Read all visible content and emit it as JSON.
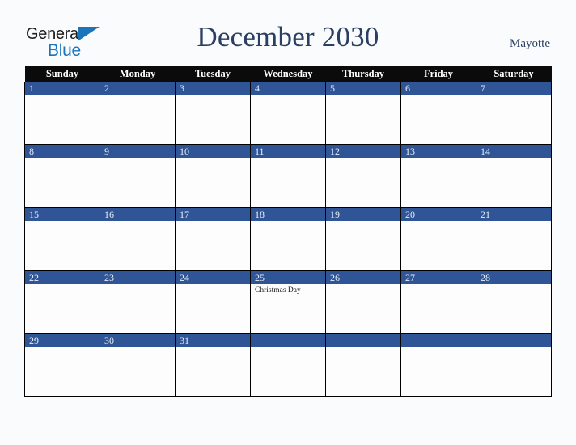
{
  "brand": {
    "name_part1": "General",
    "name_part2": "Blue",
    "triangle_icon": "triangle-logo-icon",
    "accent_color": "#1b75bc"
  },
  "header": {
    "title": "December 2030",
    "month": "December",
    "year": "2030",
    "location": "Mayotte",
    "title_color": "#2a3f63"
  },
  "calendar": {
    "header_bg": "#0b0b0b",
    "daynum_bg": "#2f5596",
    "daynum_color": "#e9eef7",
    "cell_bg": "#fdfdfd",
    "weekdays": [
      "Sunday",
      "Monday",
      "Tuesday",
      "Wednesday",
      "Thursday",
      "Friday",
      "Saturday"
    ],
    "weeks": [
      [
        {
          "day": "1",
          "events": []
        },
        {
          "day": "2",
          "events": []
        },
        {
          "day": "3",
          "events": []
        },
        {
          "day": "4",
          "events": []
        },
        {
          "day": "5",
          "events": []
        },
        {
          "day": "6",
          "events": []
        },
        {
          "day": "7",
          "events": []
        }
      ],
      [
        {
          "day": "8",
          "events": []
        },
        {
          "day": "9",
          "events": []
        },
        {
          "day": "10",
          "events": []
        },
        {
          "day": "11",
          "events": []
        },
        {
          "day": "12",
          "events": []
        },
        {
          "day": "13",
          "events": []
        },
        {
          "day": "14",
          "events": []
        }
      ],
      [
        {
          "day": "15",
          "events": []
        },
        {
          "day": "16",
          "events": []
        },
        {
          "day": "17",
          "events": []
        },
        {
          "day": "18",
          "events": []
        },
        {
          "day": "19",
          "events": []
        },
        {
          "day": "20",
          "events": []
        },
        {
          "day": "21",
          "events": []
        }
      ],
      [
        {
          "day": "22",
          "events": []
        },
        {
          "day": "23",
          "events": []
        },
        {
          "day": "24",
          "events": []
        },
        {
          "day": "25",
          "events": [
            "Christmas Day"
          ]
        },
        {
          "day": "26",
          "events": []
        },
        {
          "day": "27",
          "events": []
        },
        {
          "day": "28",
          "events": []
        }
      ],
      [
        {
          "day": "29",
          "events": []
        },
        {
          "day": "30",
          "events": []
        },
        {
          "day": "31",
          "events": []
        },
        {
          "day": "",
          "events": []
        },
        {
          "day": "",
          "events": []
        },
        {
          "day": "",
          "events": []
        },
        {
          "day": "",
          "events": []
        }
      ]
    ]
  }
}
